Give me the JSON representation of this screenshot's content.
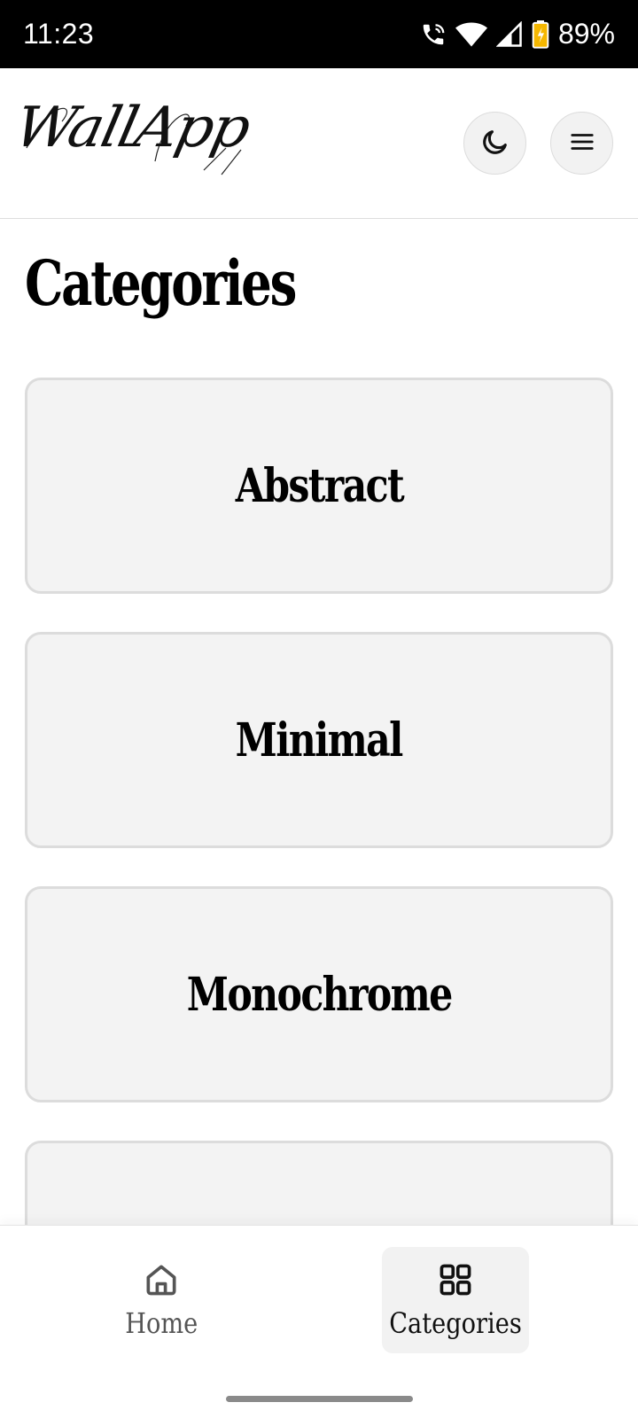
{
  "status_bar": {
    "time": "11:23",
    "battery": "89%",
    "icons": [
      "call-wifi-icon",
      "wifi-icon",
      "signal-icon",
      "battery-icon"
    ]
  },
  "header": {
    "logo_text": "WallApp",
    "theme_icon": "moon-icon",
    "menu_icon": "hamburger-menu-icon"
  },
  "main": {
    "title": "Categories",
    "categories": [
      {
        "label": "Abstract"
      },
      {
        "label": "Minimal"
      },
      {
        "label": "Monochrome"
      }
    ]
  },
  "bottom_nav": {
    "items": [
      {
        "label": "Home",
        "icon": "home-icon",
        "active": false
      },
      {
        "label": "Categories",
        "icon": "grid-icon",
        "active": true
      }
    ]
  },
  "colors": {
    "card_bg": "#f3f3f3",
    "card_border": "#dcdcdc",
    "active_nav_bg": "#f2f2f2",
    "battery_accent": "#f5b700"
  }
}
